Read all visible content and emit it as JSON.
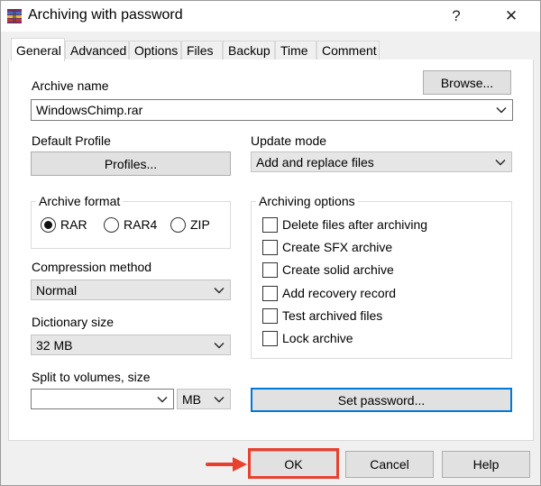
{
  "window": {
    "title": "Archiving with password",
    "help_glyph": "?",
    "close_glyph": "✕",
    "icon": "winrar-archive-icon"
  },
  "tabs": [
    {
      "label": "General",
      "active": true
    },
    {
      "label": "Advanced",
      "active": false
    },
    {
      "label": "Options",
      "active": false
    },
    {
      "label": "Files",
      "active": false
    },
    {
      "label": "Backup",
      "active": false
    },
    {
      "label": "Time",
      "active": false
    },
    {
      "label": "Comment",
      "active": false
    }
  ],
  "general": {
    "archive_name_label": "Archive name",
    "browse_label": "Browse...",
    "archive_name_value": "WindowsChimp.rar",
    "default_profile_label": "Default Profile",
    "profiles_label": "Profiles...",
    "update_mode_label": "Update mode",
    "update_mode_value": "Add and replace files",
    "archive_format": {
      "label": "Archive format",
      "options": [
        {
          "label": "RAR",
          "checked": true
        },
        {
          "label": "RAR4",
          "checked": false
        },
        {
          "label": "ZIP",
          "checked": false
        }
      ]
    },
    "compression_method_label": "Compression method",
    "compression_method_value": "Normal",
    "dictionary_size_label": "Dictionary size",
    "dictionary_size_value": "32 MB",
    "split_label": "Split to volumes, size",
    "split_value": "",
    "split_unit": "MB",
    "archiving_options": {
      "label": "Archiving options",
      "items": [
        {
          "label": "Delete files after archiving",
          "checked": false
        },
        {
          "label": "Create SFX archive",
          "checked": false
        },
        {
          "label": "Create solid archive",
          "checked": false
        },
        {
          "label": "Add recovery record",
          "checked": false
        },
        {
          "label": "Test archived files",
          "checked": false
        },
        {
          "label": "Lock archive",
          "checked": false
        }
      ]
    },
    "set_password_label": "Set password..."
  },
  "buttons": {
    "ok": "OK",
    "cancel": "Cancel",
    "help": "Help"
  },
  "annotation": {
    "highlight_color": "#e8412f",
    "target": "ok-button"
  },
  "colors": {
    "accent_border": "#0078d7",
    "highlight": "#e8412f"
  }
}
